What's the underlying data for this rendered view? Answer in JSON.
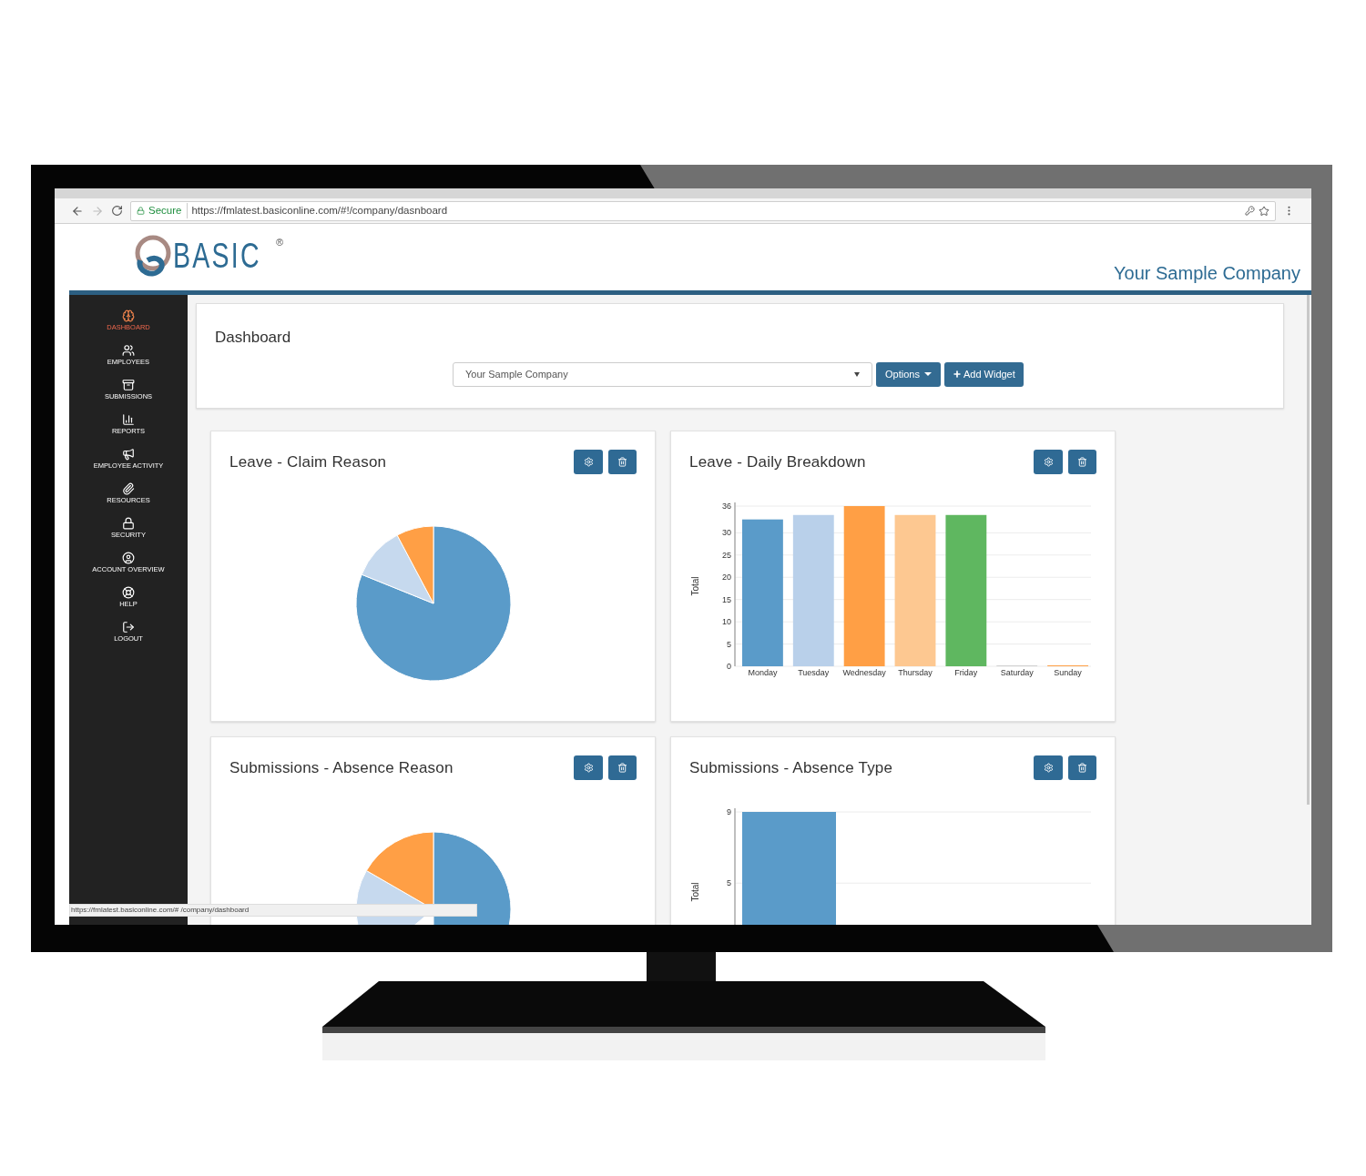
{
  "browser": {
    "secure_label": "Secure",
    "url": "https://fmlatest.basiconline.com/#!/company/dasnboard"
  },
  "header": {
    "logo_text": "BASIC",
    "logo_mark": "®",
    "company": "Your Sample Company"
  },
  "sidebar": {
    "items": [
      {
        "label": "DASHBOARD",
        "selected": true
      },
      {
        "label": "EMPLOYEES",
        "selected": false
      },
      {
        "label": "SUBMISSIONS",
        "selected": false
      },
      {
        "label": "REPORTS",
        "selected": false
      },
      {
        "label": "EMPLOYEE ACTIVITY",
        "selected": false
      },
      {
        "label": "RESOURCES",
        "selected": false
      },
      {
        "label": "SECURITY",
        "selected": false
      },
      {
        "label": "ACCOUNT OVERVIEW",
        "selected": false
      },
      {
        "label": "HELP",
        "selected": false
      },
      {
        "label": "LOGOUT",
        "selected": false
      }
    ]
  },
  "dashboard": {
    "title": "Dashboard",
    "company_select": "Your Sample Company",
    "options_button": "Options",
    "add_widget_button": "Add Widget"
  },
  "widgets": [
    {
      "title": "Leave - Claim Reason",
      "kind": "pie"
    },
    {
      "title": "Leave - Daily Breakdown",
      "kind": "bar",
      "chart_data": {
        "type": "bar",
        "ylabel": "Total",
        "stacked": true,
        "grid": true,
        "series": [
          {
            "name": "Monday",
            "color": "#5a9bc9",
            "values": [
              33,
              null,
              null,
              null,
              null,
              null,
              null
            ]
          },
          {
            "name": "Tuesday",
            "color": "#b9d0ea",
            "values": [
              null,
              34,
              null,
              null,
              null,
              null,
              null
            ]
          },
          {
            "name": "Wednesday",
            "color": "#ff9f45",
            "values": [
              null,
              null,
              36,
              null,
              null,
              null,
              null
            ]
          },
          {
            "name": "Thursday",
            "color": "#fdc891",
            "values": [
              null,
              null,
              null,
              34,
              null,
              null,
              null
            ]
          },
          {
            "name": "Friday",
            "color": "#5fb760",
            "values": [
              null,
              null,
              null,
              null,
              34,
              null,
              null
            ]
          },
          {
            "name": "Saturday",
            "color": "#d0d0d0",
            "values": [
              null,
              null,
              null,
              null,
              null,
              0,
              null
            ]
          },
          {
            "name": "Sunday",
            "color": "#ff9f45",
            "values": [
              null,
              null,
              null,
              null,
              null,
              null,
              0
            ]
          }
        ],
        "ylim": [
          0,
          36
        ],
        "yticks": [
          0,
          5,
          10,
          15,
          20,
          25,
          30,
          36
        ]
      }
    },
    {
      "title": "Submissions - Absence Reason",
      "kind": "pie"
    },
    {
      "title": "Submissions - Absence Type",
      "kind": "bar",
      "chart_data": {
        "type": "bar",
        "ylabel": "Total",
        "grid": true,
        "series": [
          {
            "color": "#5a9bc9",
            "values": [
              9
            ]
          }
        ],
        "ylim": [
          0,
          9
        ],
        "yticks": [
          5,
          9
        ]
      }
    }
  ],
  "status_url": "https://fmlatest.basiconline.com/# /company/dashboard"
}
